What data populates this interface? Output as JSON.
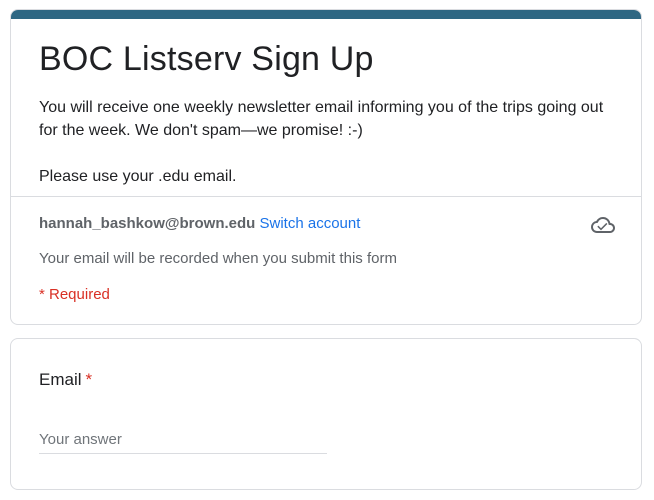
{
  "form": {
    "accent_color": "#2e6783",
    "title": "BOC Listserv Sign Up",
    "description_lines": [
      "You will receive one weekly newsletter email informing you of the trips going out",
      "for the week. We don't spam—we promise! :-)",
      "",
      "Please use your .edu email."
    ]
  },
  "account": {
    "email": "hannah_bashkow@brown.edu",
    "switch_label": "Switch account",
    "cloud_icon": "cloud-check-icon",
    "record_note": "Your email will be recorded when you submit this form",
    "required_note": "* Required"
  },
  "question": {
    "label": "Email",
    "required_mark": "*",
    "placeholder": "Your answer",
    "value": ""
  }
}
